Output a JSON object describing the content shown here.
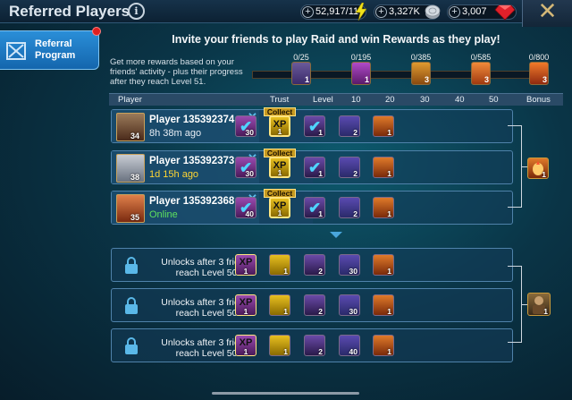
{
  "header": {
    "title": "Referred Players",
    "info_glyph": "i",
    "close_glyph": "✕",
    "resources": [
      {
        "name": "energy",
        "value": "52,917/11",
        "icon": "lightning-icon",
        "color": "#f1e21b"
      },
      {
        "name": "silver",
        "value": "3,327K",
        "icon": "silver-coin-icon",
        "color": "#c5ccd4"
      },
      {
        "name": "gems",
        "value": "3,007",
        "icon": "ruby-icon",
        "color": "#e0202a"
      }
    ],
    "plus_glyph": "+"
  },
  "sidebar": {
    "tab_label": "Referral Program",
    "tab_icon": "referral-icon",
    "has_notification": true
  },
  "intro": {
    "headline": "Invite your friends to play Raid and win Rewards as they play!",
    "description": "Get more rewards based on your friends' activity - plus their progress after they reach Level 51."
  },
  "milestones": [
    {
      "label": "0/25",
      "count": "1"
    },
    {
      "label": "0/195",
      "count": "1"
    },
    {
      "label": "0/385",
      "count": "3"
    },
    {
      "label": "0/585",
      "count": "3"
    },
    {
      "label": "0/800",
      "count": "3"
    }
  ],
  "columns": [
    "Player",
    "Trust",
    "Level",
    "10",
    "20",
    "30",
    "40",
    "50",
    "Bonus"
  ],
  "players": [
    {
      "name": "Player 135392374",
      "status": "8h 38m ago",
      "status_color": "#e8eef5",
      "level": "34",
      "collect_label": "Collect",
      "rewards": [
        {
          "label": "30"
        },
        {
          "label": "XP",
          "sub": "1"
        },
        {
          "label": "1"
        },
        {
          "label": "2"
        },
        {
          "label": "1"
        }
      ]
    },
    {
      "name": "Player 135392373",
      "status": "1d 15h ago",
      "status_color": "#ffd633",
      "level": "38",
      "collect_label": "Collect",
      "rewards": [
        {
          "label": "30"
        },
        {
          "label": "XP",
          "sub": "1"
        },
        {
          "label": "1"
        },
        {
          "label": "2"
        },
        {
          "label": "1"
        }
      ]
    },
    {
      "name": "Player 135392368",
      "status": "Online",
      "status_color": "#5ee05e",
      "level": "35",
      "collect_label": "Collect",
      "rewards": [
        {
          "label": "40"
        },
        {
          "label": "XP",
          "sub": "1"
        },
        {
          "label": "1"
        },
        {
          "label": "2"
        },
        {
          "label": "1"
        }
      ]
    }
  ],
  "bonus_top": {
    "count": "1"
  },
  "locked_tiers": [
    {
      "text": "Unlocks after 3 friends reach Level 50.",
      "rewards": [
        {
          "label": "XP",
          "sub": "1"
        },
        {
          "label": "1"
        },
        {
          "label": "2"
        },
        {
          "label": "30"
        },
        {
          "label": "1"
        }
      ]
    },
    {
      "text": "Unlocks after 3 friends reach Level 50.",
      "rewards": [
        {
          "label": "XP",
          "sub": "1"
        },
        {
          "label": "1"
        },
        {
          "label": "2"
        },
        {
          "label": "30"
        },
        {
          "label": "1"
        }
      ]
    },
    {
      "text": "Unlocks after 3 friends reach Level 50.",
      "rewards": [
        {
          "label": "XP",
          "sub": "1"
        },
        {
          "label": "1"
        },
        {
          "label": "2"
        },
        {
          "label": "40"
        },
        {
          "label": "1"
        }
      ]
    }
  ],
  "bonus_bottom": {
    "count": "1"
  },
  "reward_kinds": [
    "leveled-champion-icon",
    "xp-brew-icon",
    "potion-icon",
    "shard-icon",
    "chicken-icon"
  ],
  "remove_glyph": "✕",
  "tick_glyph": "✔"
}
